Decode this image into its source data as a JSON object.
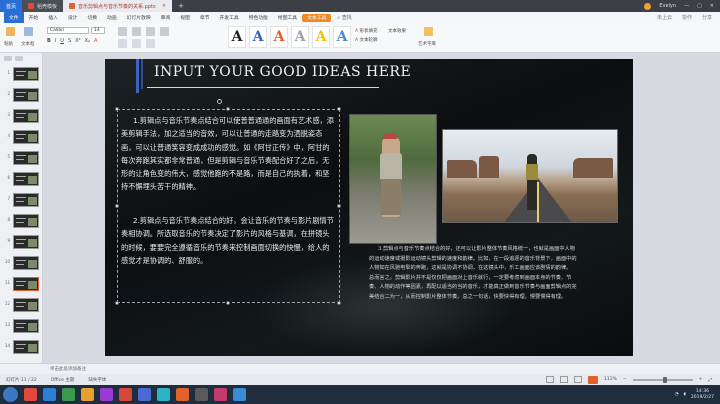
{
  "titlebar": {
    "home_tab": "首页",
    "tabs": [
      "稻壳模板",
      "音乐剪辑点与音乐节奏的关系.pptx"
    ],
    "user": "Evelyn"
  },
  "menubar": {
    "items": [
      "文件",
      "开始",
      "插入",
      "设计",
      "切换",
      "动画",
      "幻灯片放映",
      "审阅",
      "视图",
      "章节",
      "开发工具",
      "特色功能",
      "绘图工具",
      "文本工具"
    ],
    "highlight": "文本工具",
    "search": "查找",
    "right_items": [
      "未上云",
      "协作",
      "分享"
    ]
  },
  "ribbon": {
    "font_name": "Calibri",
    "font_size": "14",
    "labels": [
      "粘贴",
      "文本框",
      "形状填充",
      "文本轮廓",
      "文本效果",
      "艺术字库"
    ],
    "style_letters": [
      "A",
      "A",
      "A",
      "A",
      "A",
      "A"
    ],
    "style_colors": [
      "#222222",
      "#3b63c4",
      "#e0622a",
      "#9aa3ad",
      "#f2c200",
      "#4a8ad8"
    ]
  },
  "thumbnails": {
    "numbers": [
      "1",
      "2",
      "3",
      "4",
      "5",
      "6",
      "7",
      "8",
      "9",
      "10",
      "11",
      "12",
      "13",
      "14"
    ],
    "active_index": 10
  },
  "slide": {
    "title": "INPUT YOUR GOOD IDEAS HERE",
    "para1": "1.剪辑点与音乐节奏点结合可以使普普通通的画面有艺术感，添美剪辑手法，加之适当的音效，可以让普通的走路变为洒脱姿态画，可以让普通笑容变成成功的感觉。如《阿甘正传》中，阿甘的每次奔跑其实都非常普通，但是剪辑与音乐节奏配合好了之后，无形的让角色变的伟大，感觉他跑的不是路，而是自己的执着，和坚持不懈埋头苦干的精神。",
    "para2": "2.剪辑点与音乐节奏点结合的好，会让音乐的节奏与影片剧情节奏相协调。所选取音乐的节奏决定了影片的风格与基调，在拼镜头的时候，要要完全遵循音乐的节奏来控制画面切换的快慢，给人的感觉才是协调的、舒服的。",
    "caption": "3.剪辑点与音乐节奏点结合的好，还可以让影片整体节奏风格统一，也就是画面中人物的运动速度或摄影运动镜头剪辑的速度和韵律。比如，在一段追逐的音乐背景下，画面中的人物如在风驰电掣的奔跑，这就是协调不协调，在这镜头中，乐工画面应该剧情的韵律。    总而言之，剪辑影片并不是仅仅把画面对上音乐就行，一定要考虑到画面本身的节奏、节奏、人物的动作等因素，再配以适当的当的音乐，才能真正做到音乐节奏与画面剪辑点的完美结合二为一，从而控制影片整体节奏。总之一句话，快要快得有理，慢要慢得有理。"
  },
  "notes": {
    "placeholder": "单击此处添加备注"
  },
  "statusbar": {
    "slide_info": "幻灯片 11 / 22",
    "theme": "Office 主题",
    "font_missing": "缺失字体",
    "zoom": "111%"
  },
  "taskbar": {
    "time": "14:36",
    "date": "2019/2/27"
  },
  "colors": {
    "accent": "#3b63c4",
    "active_tab": "#e0622a",
    "file_menu": "#2b6fd6"
  }
}
